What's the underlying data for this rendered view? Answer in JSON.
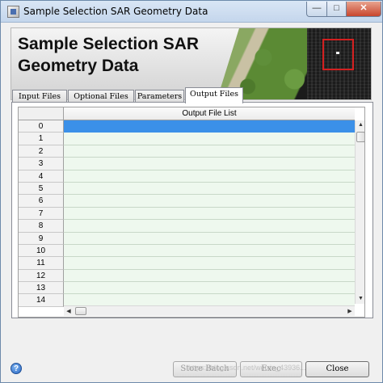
{
  "window": {
    "title": "Sample Selection SAR Geometry Data",
    "minimize": "—",
    "maximize": "□",
    "close": "✕"
  },
  "banner": {
    "title": "Sample Selection SAR Geometry Data"
  },
  "tabs": [
    {
      "label": "Input Files",
      "active": false
    },
    {
      "label": "Optional Files",
      "active": false
    },
    {
      "label": "Parameters",
      "active": false
    },
    {
      "label": "Output Files",
      "active": true
    }
  ],
  "grid": {
    "column_header": "Output File List",
    "rows": [
      "0",
      "1",
      "2",
      "3",
      "4",
      "5",
      "6",
      "7",
      "8",
      "9",
      "10",
      "11",
      "12",
      "13",
      "14"
    ],
    "selected_row": 0,
    "colors": {
      "selected": "#3b90e8",
      "cell": "#eef8ee"
    }
  },
  "scroll": {
    "up": "▲",
    "down": "▼",
    "left": "◀",
    "right": "▶"
  },
  "buttons": {
    "help": "?",
    "store_batch": "Store Batch",
    "exec": "Exec",
    "close": "Close"
  },
  "watermark": "https://blog.csdn.net/weixin_43936..."
}
